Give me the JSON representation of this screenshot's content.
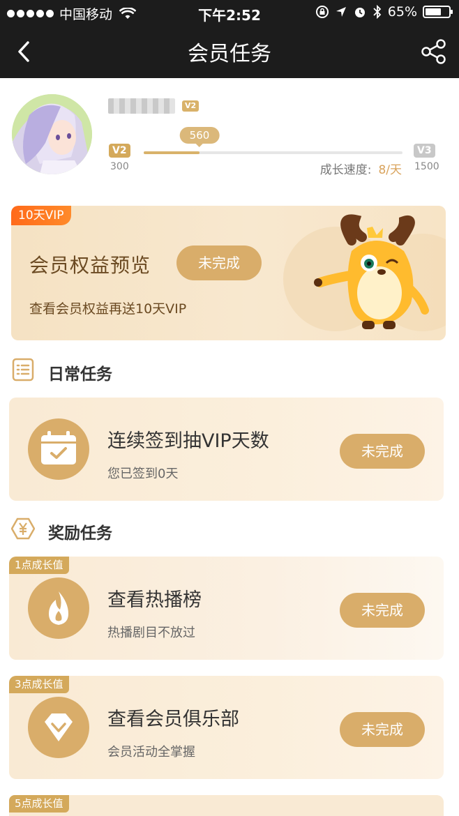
{
  "status_bar": {
    "carrier": "中国移动",
    "time": "下午2:52",
    "battery": "65%"
  },
  "nav": {
    "title": "会员任务"
  },
  "profile": {
    "level_tag": "V2",
    "current_level": "V2",
    "next_level": "V3",
    "current_min": "300",
    "next_min": "1500",
    "points": "560",
    "progress_fraction": 0.216,
    "speed_label": "成长速度:",
    "speed_value": "8/天"
  },
  "banner": {
    "tag": "10天VIP",
    "title": "会员权益预览",
    "subtitle": "查看会员权益再送10天VIP",
    "button": "未完成"
  },
  "daily": {
    "section_title": "日常任务",
    "task": {
      "title": "连续签到抽VIP天数",
      "subtitle": "您已签到0天",
      "button": "未完成"
    }
  },
  "reward": {
    "section_title": "奖励任务",
    "tasks": [
      {
        "tag": "1点成长值",
        "title": "查看热播榜",
        "subtitle": "热播剧目不放过",
        "button": "未完成",
        "icon": "flame-icon"
      },
      {
        "tag": "3点成长值",
        "title": "查看会员俱乐部",
        "subtitle": "会员活动全掌握",
        "button": "未完成",
        "icon": "diamond-icon"
      },
      {
        "tag": "5点成长值"
      }
    ]
  },
  "colors": {
    "gold": "#d9ad6a",
    "orange_tag": "#ff6a1a",
    "card_bg": "#f9ead4",
    "nav_bg": "#1c1c1c"
  }
}
